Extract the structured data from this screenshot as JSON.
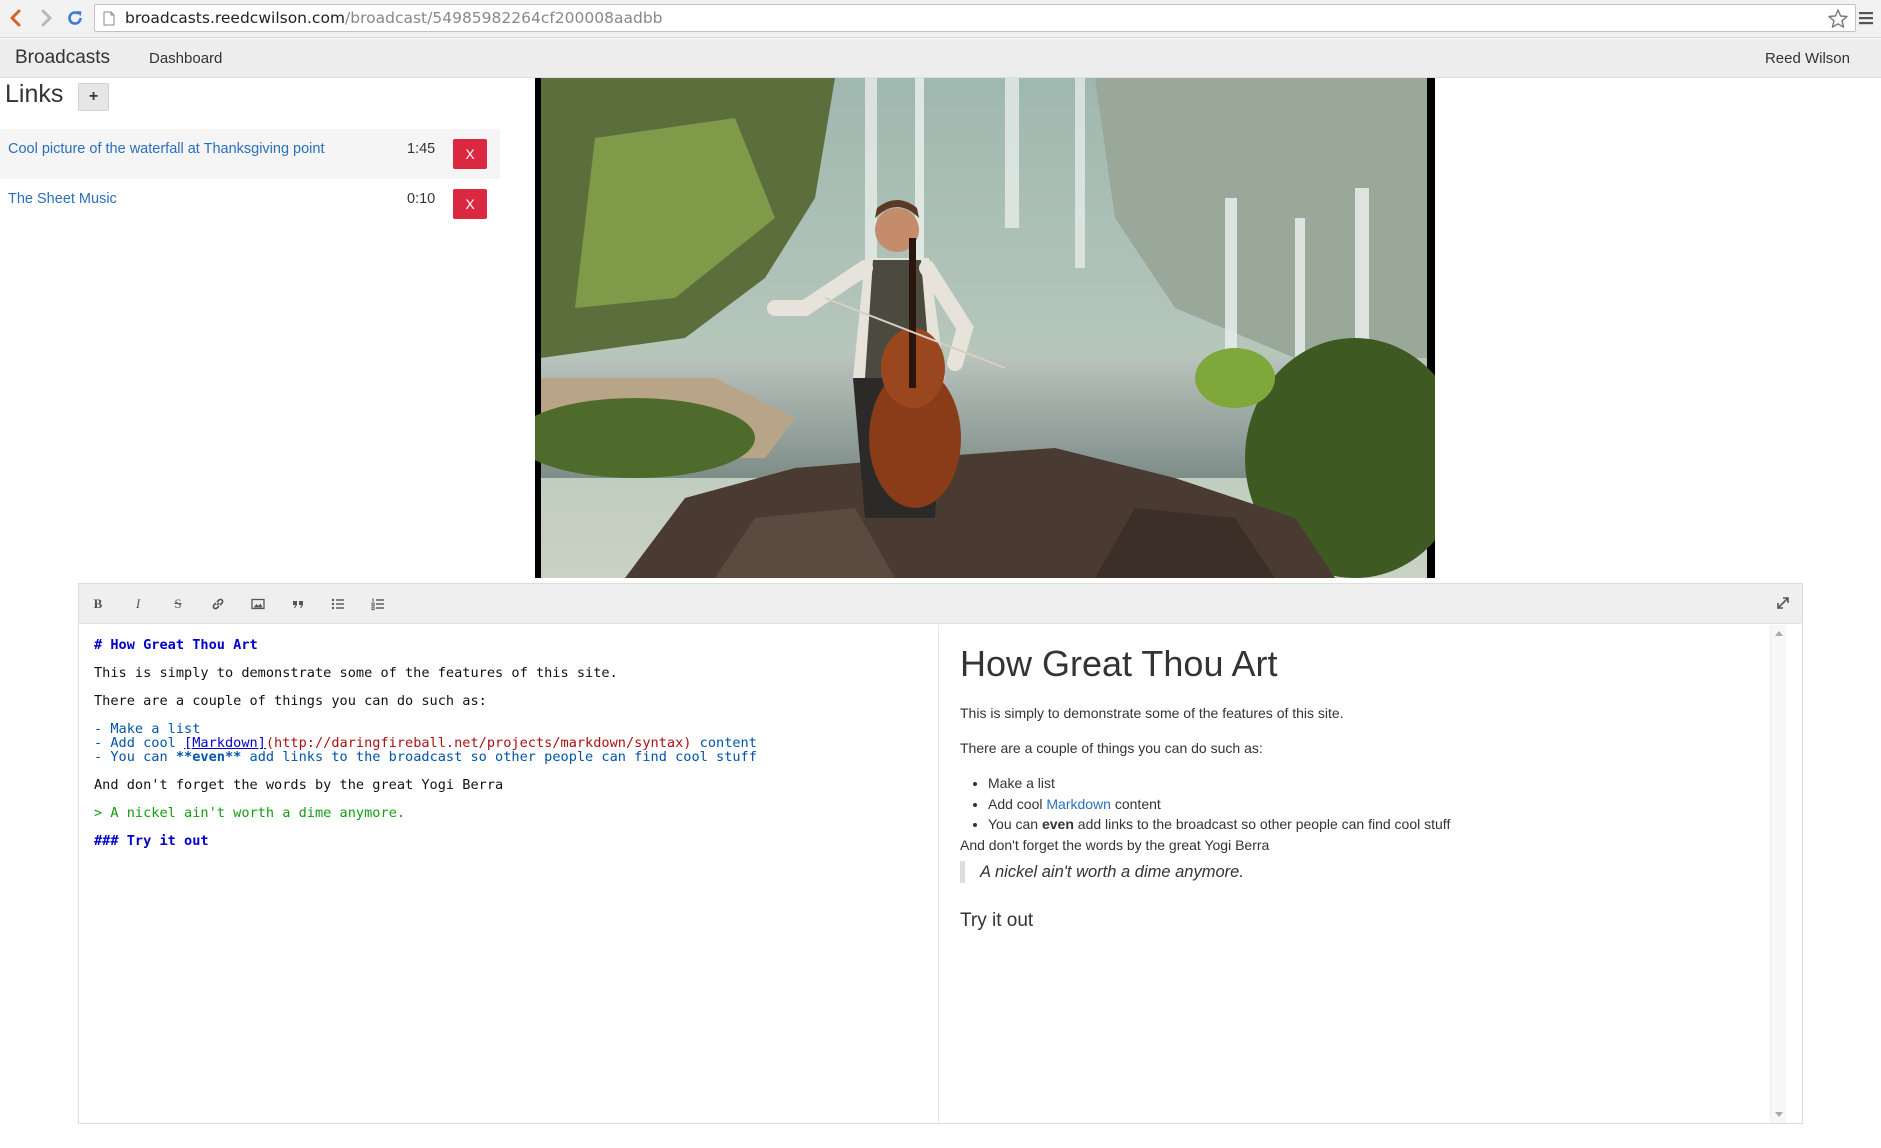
{
  "browser": {
    "url_host": "broadcasts.reedcwilson.com",
    "url_path": "/broadcast/54985982264cf200008aadbb"
  },
  "navbar": {
    "brand": "Broadcasts",
    "dashboard": "Dashboard",
    "user": "Reed Wilson"
  },
  "links_panel": {
    "title": "Links",
    "add_label": "+",
    "items": [
      {
        "title": "Cool picture of the waterfall at Thanksgiving point",
        "time": "1:45",
        "delete_label": "X"
      },
      {
        "title": "The Sheet Music",
        "time": "0:10",
        "delete_label": "X"
      }
    ]
  },
  "video": {
    "icon": "video-frame-cellist-waterfall"
  },
  "editor": {
    "toolbar": {
      "bold": "B",
      "italic": "I",
      "strike": "S"
    },
    "source": {
      "line1": "# How Great Thou Art",
      "line2": "This is simply to demonstrate some of the features of this site.",
      "line3": "There are a couple of things you can do such as:",
      "line4": "- Make a list",
      "line5_a": "- Add cool ",
      "line5_link": "[Markdown]",
      "line5_url": "(http://daringfireball.net/projects/markdown/syntax)",
      "line5_b": " content",
      "line6_a": "- You can ",
      "line6_strong": "**even**",
      "line6_b": " add links to the broadcast so other people can find cool stuff",
      "line7": "And don't forget the words by the great Yogi Berra",
      "line8": "> A nickel ain't worth a dime anymore.",
      "line9": "### Try it out"
    },
    "preview": {
      "h1": "How Great Thou Art",
      "p1": "This is simply to demonstrate some of the features of this site.",
      "p2": "There are a couple of things you can do such as:",
      "li1": "Make a list",
      "li2_a": "Add cool ",
      "li2_link": "Markdown",
      "li2_b": " content",
      "li3_a": "You can ",
      "li3_strong": "even",
      "li3_b": " add links to the broadcast so other people can find cool stuff",
      "p3": "And don't forget the words by the great Yogi Berra",
      "quote": "A nickel ain't worth a dime anymore.",
      "h3": "Try it out"
    }
  }
}
